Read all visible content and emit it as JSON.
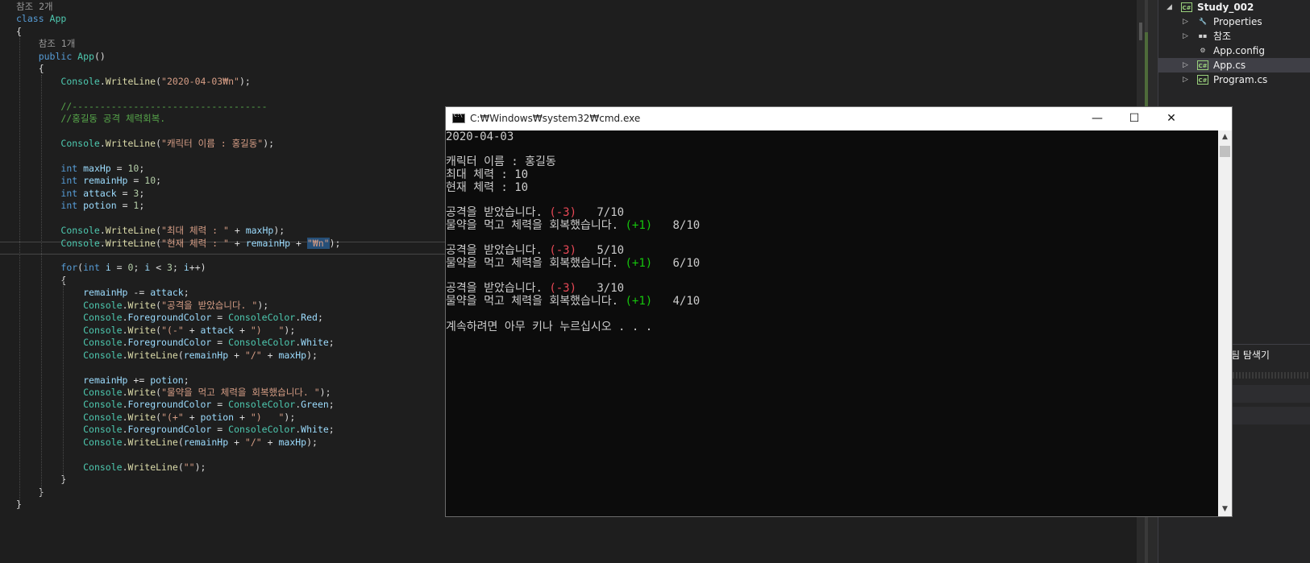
{
  "editor": {
    "lines": [
      [
        {
          "t": "참조 2개",
          "c": "ref"
        }
      ],
      [
        {
          "t": "class ",
          "c": "kw"
        },
        {
          "t": "App",
          "c": "cls"
        }
      ],
      [
        {
          "t": "{",
          "c": ""
        }
      ],
      [
        {
          "t": "    참조 1개",
          "c": "ref"
        }
      ],
      [
        {
          "t": "    ",
          "c": ""
        },
        {
          "t": "public ",
          "c": "kw"
        },
        {
          "t": "App",
          "c": "cls"
        },
        {
          "t": "()",
          "c": ""
        }
      ],
      [
        {
          "t": "    {",
          "c": ""
        }
      ],
      [
        {
          "t": "        ",
          "c": ""
        },
        {
          "t": "Console",
          "c": "cls"
        },
        {
          "t": ".",
          "c": ""
        },
        {
          "t": "WriteLine",
          "c": "meth"
        },
        {
          "t": "(",
          "c": ""
        },
        {
          "t": "\"2020-04-03₩n\"",
          "c": "str"
        },
        {
          "t": ");",
          "c": ""
        }
      ],
      [
        {
          "t": "",
          "c": ""
        }
      ],
      [
        {
          "t": "        //-----------------------------------",
          "c": "cmt"
        }
      ],
      [
        {
          "t": "        //홍길동 공격 체력회복.",
          "c": "cmt"
        }
      ],
      [
        {
          "t": "",
          "c": ""
        }
      ],
      [
        {
          "t": "        ",
          "c": ""
        },
        {
          "t": "Console",
          "c": "cls"
        },
        {
          "t": ".",
          "c": ""
        },
        {
          "t": "WriteLine",
          "c": "meth"
        },
        {
          "t": "(",
          "c": ""
        },
        {
          "t": "\"캐릭터 이름 : 홍길동\"",
          "c": "str"
        },
        {
          "t": ");",
          "c": ""
        }
      ],
      [
        {
          "t": "",
          "c": ""
        }
      ],
      [
        {
          "t": "        ",
          "c": ""
        },
        {
          "t": "int ",
          "c": "kw"
        },
        {
          "t": "maxHp",
          "c": "var"
        },
        {
          "t": " = ",
          "c": ""
        },
        {
          "t": "10",
          "c": "num"
        },
        {
          "t": ";",
          "c": ""
        }
      ],
      [
        {
          "t": "        ",
          "c": ""
        },
        {
          "t": "int ",
          "c": "kw"
        },
        {
          "t": "remainHp",
          "c": "var"
        },
        {
          "t": " = ",
          "c": ""
        },
        {
          "t": "10",
          "c": "num"
        },
        {
          "t": ";",
          "c": ""
        }
      ],
      [
        {
          "t": "        ",
          "c": ""
        },
        {
          "t": "int ",
          "c": "kw"
        },
        {
          "t": "attack",
          "c": "var"
        },
        {
          "t": " = ",
          "c": ""
        },
        {
          "t": "3",
          "c": "num"
        },
        {
          "t": ";",
          "c": ""
        }
      ],
      [
        {
          "t": "        ",
          "c": ""
        },
        {
          "t": "int ",
          "c": "kw"
        },
        {
          "t": "potion",
          "c": "var"
        },
        {
          "t": " = ",
          "c": ""
        },
        {
          "t": "1",
          "c": "num"
        },
        {
          "t": ";",
          "c": ""
        }
      ],
      [
        {
          "t": "",
          "c": ""
        }
      ],
      [
        {
          "t": "        ",
          "c": ""
        },
        {
          "t": "Console",
          "c": "cls"
        },
        {
          "t": ".",
          "c": ""
        },
        {
          "t": "WriteLine",
          "c": "meth"
        },
        {
          "t": "(",
          "c": ""
        },
        {
          "t": "\"최대 체력 : \"",
          "c": "str"
        },
        {
          "t": " + ",
          "c": ""
        },
        {
          "t": "maxHp",
          "c": "var"
        },
        {
          "t": ");",
          "c": ""
        }
      ],
      [
        {
          "t": "        ",
          "c": ""
        },
        {
          "t": "Console",
          "c": "cls"
        },
        {
          "t": ".",
          "c": ""
        },
        {
          "t": "WriteLine",
          "c": "meth"
        },
        {
          "t": "(",
          "c": ""
        },
        {
          "t": "\"현재 체력 : \"",
          "c": "str"
        },
        {
          "t": " + ",
          "c": ""
        },
        {
          "t": "remainHp",
          "c": "var"
        },
        {
          "t": " + ",
          "c": ""
        },
        {
          "t": "\"₩n\"",
          "c": "str hl"
        },
        {
          "t": ");",
          "c": ""
        }
      ],
      [
        {
          "t": "",
          "c": ""
        }
      ],
      [
        {
          "t": "        ",
          "c": ""
        },
        {
          "t": "for",
          "c": "kw"
        },
        {
          "t": "(",
          "c": ""
        },
        {
          "t": "int ",
          "c": "kw"
        },
        {
          "t": "i",
          "c": "var"
        },
        {
          "t": " = ",
          "c": ""
        },
        {
          "t": "0",
          "c": "num"
        },
        {
          "t": "; ",
          "c": ""
        },
        {
          "t": "i",
          "c": "var"
        },
        {
          "t": " < ",
          "c": ""
        },
        {
          "t": "3",
          "c": "num"
        },
        {
          "t": "; ",
          "c": ""
        },
        {
          "t": "i",
          "c": "var"
        },
        {
          "t": "++)",
          "c": ""
        }
      ],
      [
        {
          "t": "        {",
          "c": ""
        }
      ],
      [
        {
          "t": "            ",
          "c": ""
        },
        {
          "t": "remainHp",
          "c": "var"
        },
        {
          "t": " -= ",
          "c": ""
        },
        {
          "t": "attack",
          "c": "var"
        },
        {
          "t": ";",
          "c": ""
        }
      ],
      [
        {
          "t": "            ",
          "c": ""
        },
        {
          "t": "Console",
          "c": "cls"
        },
        {
          "t": ".",
          "c": ""
        },
        {
          "t": "Write",
          "c": "meth"
        },
        {
          "t": "(",
          "c": ""
        },
        {
          "t": "\"공격을 받았습니다. \"",
          "c": "str"
        },
        {
          "t": ");",
          "c": ""
        }
      ],
      [
        {
          "t": "            ",
          "c": ""
        },
        {
          "t": "Console",
          "c": "cls"
        },
        {
          "t": ".",
          "c": ""
        },
        {
          "t": "ForegroundColor",
          "c": "var"
        },
        {
          "t": " = ",
          "c": ""
        },
        {
          "t": "ConsoleColor",
          "c": "cls"
        },
        {
          "t": ".",
          "c": ""
        },
        {
          "t": "Red",
          "c": "var"
        },
        {
          "t": ";",
          "c": ""
        }
      ],
      [
        {
          "t": "            ",
          "c": ""
        },
        {
          "t": "Console",
          "c": "cls"
        },
        {
          "t": ".",
          "c": ""
        },
        {
          "t": "Write",
          "c": "meth"
        },
        {
          "t": "(",
          "c": ""
        },
        {
          "t": "\"(-\"",
          "c": "str"
        },
        {
          "t": " + ",
          "c": ""
        },
        {
          "t": "attack",
          "c": "var"
        },
        {
          "t": " + ",
          "c": ""
        },
        {
          "t": "\")   \"",
          "c": "str"
        },
        {
          "t": ");",
          "c": ""
        }
      ],
      [
        {
          "t": "            ",
          "c": ""
        },
        {
          "t": "Console",
          "c": "cls"
        },
        {
          "t": ".",
          "c": ""
        },
        {
          "t": "ForegroundColor",
          "c": "var"
        },
        {
          "t": " = ",
          "c": ""
        },
        {
          "t": "ConsoleColor",
          "c": "cls"
        },
        {
          "t": ".",
          "c": ""
        },
        {
          "t": "White",
          "c": "var"
        },
        {
          "t": ";",
          "c": ""
        }
      ],
      [
        {
          "t": "            ",
          "c": ""
        },
        {
          "t": "Console",
          "c": "cls"
        },
        {
          "t": ".",
          "c": ""
        },
        {
          "t": "WriteLine",
          "c": "meth"
        },
        {
          "t": "(",
          "c": ""
        },
        {
          "t": "remainHp",
          "c": "var"
        },
        {
          "t": " + ",
          "c": ""
        },
        {
          "t": "\"/\"",
          "c": "str"
        },
        {
          "t": " + ",
          "c": ""
        },
        {
          "t": "maxHp",
          "c": "var"
        },
        {
          "t": ");",
          "c": ""
        }
      ],
      [
        {
          "t": "",
          "c": ""
        }
      ],
      [
        {
          "t": "            ",
          "c": ""
        },
        {
          "t": "remainHp",
          "c": "var"
        },
        {
          "t": " += ",
          "c": ""
        },
        {
          "t": "potion",
          "c": "var"
        },
        {
          "t": ";",
          "c": ""
        }
      ],
      [
        {
          "t": "            ",
          "c": ""
        },
        {
          "t": "Console",
          "c": "cls"
        },
        {
          "t": ".",
          "c": ""
        },
        {
          "t": "Write",
          "c": "meth"
        },
        {
          "t": "(",
          "c": ""
        },
        {
          "t": "\"물약을 먹고 체력을 회복했습니다. \"",
          "c": "str"
        },
        {
          "t": ");",
          "c": ""
        }
      ],
      [
        {
          "t": "            ",
          "c": ""
        },
        {
          "t": "Console",
          "c": "cls"
        },
        {
          "t": ".",
          "c": ""
        },
        {
          "t": "ForegroundColor",
          "c": "var"
        },
        {
          "t": " = ",
          "c": ""
        },
        {
          "t": "ConsoleColor",
          "c": "cls"
        },
        {
          "t": ".",
          "c": ""
        },
        {
          "t": "Green",
          "c": "var"
        },
        {
          "t": ";",
          "c": ""
        }
      ],
      [
        {
          "t": "            ",
          "c": ""
        },
        {
          "t": "Console",
          "c": "cls"
        },
        {
          "t": ".",
          "c": ""
        },
        {
          "t": "Write",
          "c": "meth"
        },
        {
          "t": "(",
          "c": ""
        },
        {
          "t": "\"(+\"",
          "c": "str"
        },
        {
          "t": " + ",
          "c": ""
        },
        {
          "t": "potion",
          "c": "var"
        },
        {
          "t": " + ",
          "c": ""
        },
        {
          "t": "\")   \"",
          "c": "str"
        },
        {
          "t": ");",
          "c": ""
        }
      ],
      [
        {
          "t": "            ",
          "c": ""
        },
        {
          "t": "Console",
          "c": "cls"
        },
        {
          "t": ".",
          "c": ""
        },
        {
          "t": "ForegroundColor",
          "c": "var"
        },
        {
          "t": " = ",
          "c": ""
        },
        {
          "t": "ConsoleColor",
          "c": "cls"
        },
        {
          "t": ".",
          "c": ""
        },
        {
          "t": "White",
          "c": "var"
        },
        {
          "t": ";",
          "c": ""
        }
      ],
      [
        {
          "t": "            ",
          "c": ""
        },
        {
          "t": "Console",
          "c": "cls"
        },
        {
          "t": ".",
          "c": ""
        },
        {
          "t": "WriteLine",
          "c": "meth"
        },
        {
          "t": "(",
          "c": ""
        },
        {
          "t": "remainHp",
          "c": "var"
        },
        {
          "t": " + ",
          "c": ""
        },
        {
          "t": "\"/\"",
          "c": "str"
        },
        {
          "t": " + ",
          "c": ""
        },
        {
          "t": "maxHp",
          "c": "var"
        },
        {
          "t": ");",
          "c": ""
        }
      ],
      [
        {
          "t": "",
          "c": ""
        }
      ],
      [
        {
          "t": "            ",
          "c": ""
        },
        {
          "t": "Console",
          "c": "cls"
        },
        {
          "t": ".",
          "c": ""
        },
        {
          "t": "WriteLine",
          "c": "meth"
        },
        {
          "t": "(",
          "c": ""
        },
        {
          "t": "\"\"",
          "c": "str"
        },
        {
          "t": ");",
          "c": ""
        }
      ],
      [
        {
          "t": "        }",
          "c": ""
        }
      ],
      [
        {
          "t": "    }",
          "c": ""
        }
      ],
      [
        {
          "t": "}",
          "c": ""
        }
      ]
    ]
  },
  "cmd": {
    "title": "C:₩Windows₩system32₩cmd.exe",
    "minimize_glyph": "—",
    "maximize_glyph": "☐",
    "close_glyph": "✕",
    "scroll_up_glyph": "▲",
    "scroll_down_glyph": "▼",
    "lines": [
      [
        {
          "t": "2020-04-03",
          "c": ""
        }
      ],
      [
        {
          "t": "",
          "c": ""
        }
      ],
      [
        {
          "t": "캐릭터 이름 : 홍길동",
          "c": ""
        }
      ],
      [
        {
          "t": "최대 체력 : 10",
          "c": ""
        }
      ],
      [
        {
          "t": "현재 체력 : 10",
          "c": ""
        }
      ],
      [
        {
          "t": "",
          "c": ""
        }
      ],
      [
        {
          "t": "공격을 받았습니다. ",
          "c": ""
        },
        {
          "t": "(-3)",
          "c": "con-red"
        },
        {
          "t": "   7/10",
          "c": ""
        }
      ],
      [
        {
          "t": "물약을 먹고 체력을 회복했습니다. ",
          "c": ""
        },
        {
          "t": "(+1)",
          "c": "con-green"
        },
        {
          "t": "   8/10",
          "c": ""
        }
      ],
      [
        {
          "t": "",
          "c": ""
        }
      ],
      [
        {
          "t": "공격을 받았습니다. ",
          "c": ""
        },
        {
          "t": "(-3)",
          "c": "con-red"
        },
        {
          "t": "   5/10",
          "c": ""
        }
      ],
      [
        {
          "t": "물약을 먹고 체력을 회복했습니다. ",
          "c": ""
        },
        {
          "t": "(+1)",
          "c": "con-green"
        },
        {
          "t": "   6/10",
          "c": ""
        }
      ],
      [
        {
          "t": "",
          "c": ""
        }
      ],
      [
        {
          "t": "공격을 받았습니다. ",
          "c": ""
        },
        {
          "t": "(-3)",
          "c": "con-red"
        },
        {
          "t": "   3/10",
          "c": ""
        }
      ],
      [
        {
          "t": "물약을 먹고 체력을 회복했습니다. ",
          "c": ""
        },
        {
          "t": "(+1)",
          "c": "con-green"
        },
        {
          "t": "   4/10",
          "c": ""
        }
      ],
      [
        {
          "t": "",
          "c": ""
        }
      ],
      [
        {
          "t": "계속하려면 아무 키나 누르십시오 . . .",
          "c": ""
        }
      ]
    ]
  },
  "solution_explorer": {
    "items": [
      {
        "label": "Study_002",
        "icon": "csharp-project-icon",
        "icon_text": "C#",
        "has_arrow": true,
        "expanded": true,
        "level": 0,
        "selected": false,
        "bold": true
      },
      {
        "label": "Properties",
        "icon": "wrench-icon",
        "icon_text": "🔧",
        "has_arrow": true,
        "expanded": false,
        "level": 1,
        "selected": false,
        "bold": false
      },
      {
        "label": "참조",
        "icon": "references-icon",
        "icon_text": "▪▪",
        "has_arrow": true,
        "expanded": false,
        "level": 1,
        "selected": false,
        "bold": false
      },
      {
        "label": "App.config",
        "icon": "config-file-icon",
        "icon_text": "⚙",
        "has_arrow": false,
        "expanded": false,
        "level": 1,
        "selected": false,
        "bold": false
      },
      {
        "label": "App.cs",
        "icon": "csharp-file-icon",
        "icon_text": "C#",
        "has_arrow": true,
        "expanded": false,
        "level": 1,
        "selected": true,
        "bold": false
      },
      {
        "label": "Program.cs",
        "icon": "csharp-file-icon",
        "icon_text": "C#",
        "has_arrow": true,
        "expanded": false,
        "level": 1,
        "selected": false,
        "bold": false
      }
    ],
    "bottom_tab": "팀 탐색기"
  },
  "colors": {
    "console_red": "#e74856",
    "console_green": "#16c60c",
    "console_text": "#cccccc",
    "editor_bg": "#1e1e1e"
  }
}
